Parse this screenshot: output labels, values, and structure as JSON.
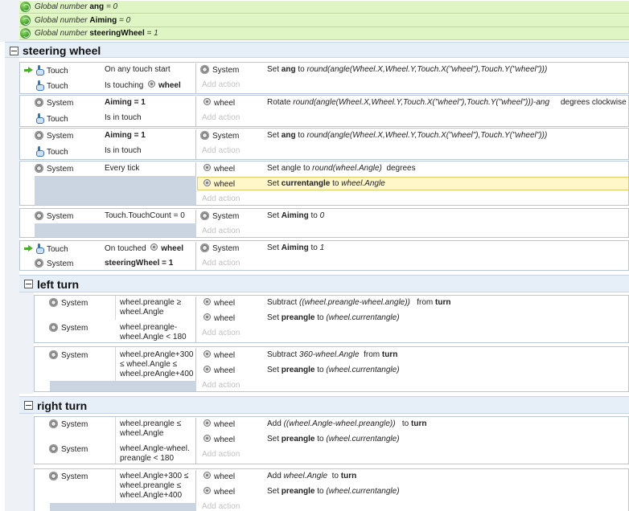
{
  "globals": [
    {
      "prefix": "Global number",
      "name": "ang",
      "suffix": "= 0"
    },
    {
      "prefix": "Global number",
      "name": "Aiming",
      "suffix": "= 0"
    },
    {
      "prefix": "Global number",
      "name": "steeringWheel",
      "suffix": "= 1"
    }
  ],
  "groups": {
    "steering": {
      "title": "steering wheel"
    },
    "left": {
      "title": "left turn"
    },
    "right": {
      "title": "right turn"
    }
  },
  "labels": {
    "touch": "Touch",
    "system": "System",
    "wheel": "wheel",
    "add_action": "Add action"
  },
  "events": {
    "e1": {
      "c1": "On any touch start",
      "c2_pre": "Is touching",
      "c2_obj": "wheel",
      "a1_pre": "Set",
      "a1_var": "ang",
      "a1_mid": "to",
      "a1_expr": "round(angle(Wheel.X,Wheel.Y,Touch.X(\"wheel\"),Touch.Y(\"wheel\")))"
    },
    "e2": {
      "c1": "Aiming = 1",
      "c2": "Is in touch",
      "a1_pre": "Rotate",
      "a1_expr": "round(angle(Wheel.X,Wheel.Y,Touch.X(\"wheel\"),Touch.Y(\"wheel\")))-ang",
      "a1_post": "degrees clockwise"
    },
    "e3": {
      "c1": "Aiming = 1",
      "c2": "Is in touch",
      "a1_pre": "Set",
      "a1_var": "ang",
      "a1_mid": "to",
      "a1_expr": "round(angle(Wheel.X,Wheel.Y,Touch.X(\"wheel\"),Touch.Y(\"wheel\")))"
    },
    "e4": {
      "c1": "Every tick",
      "a1_pre": "Set angle to",
      "a1_expr": "round(wheel.Angle)",
      "a1_post": "degrees",
      "a2_pre": "Set",
      "a2_var": "currentangle",
      "a2_mid": "to",
      "a2_expr": "wheel.Angle"
    },
    "e5": {
      "c1": "Touch.TouchCount = 0",
      "a1_pre": "Set",
      "a1_var": "Aiming",
      "a1_mid": "to",
      "a1_expr": "0"
    },
    "e6": {
      "c1_pre": "On touched",
      "c1_obj": "wheel",
      "c2": "steeringWheel = 1",
      "a1_pre": "Set",
      "a1_var": "Aiming",
      "a1_mid": "to",
      "a1_expr": "1"
    },
    "l1": {
      "c1a": "wheel.preangle ≥",
      "c1b": "wheel.Angle",
      "c2a": "wheel.preangle-",
      "c2b": "wheel.Angle < 180",
      "a1_pre": "Subtract",
      "a1_expr": "((wheel.preangle-wheel.angle))",
      "a1_mid": "from",
      "a1_var": "turn",
      "a2_pre": "Set",
      "a2_var": "preangle",
      "a2_mid": "to",
      "a2_expr": "(wheel.currentangle)"
    },
    "l2": {
      "c1a": "wheel.preAngle+300",
      "c1b": "≤ wheel.Angle ≤",
      "c1c": "wheel.preAngle+400",
      "a1_pre": "Subtract",
      "a1_expr": "360-wheel.Angle",
      "a1_mid": "from",
      "a1_var": "turn",
      "a2_pre": "Set",
      "a2_var": "preangle",
      "a2_mid": "to",
      "a2_expr": "(wheel.currentangle)"
    },
    "r1": {
      "c1a": "wheel.preangle ≤",
      "c1b": "wheel.Angle",
      "c2a": "wheel.Angle-wheel.",
      "c2b": "preangle < 180",
      "a1_pre": "Add",
      "a1_expr": "((wheel.Angle-wheel.preangle))",
      "a1_mid": "to",
      "a1_var": "turn",
      "a2_pre": "Set",
      "a2_var": "preangle",
      "a2_mid": "to",
      "a2_expr": "(wheel.currentangle)"
    },
    "r2": {
      "c1a": "wheel.Angle+300 ≤",
      "c1b": "wheel.preangle ≤",
      "c1c": "wheel.Angle+400",
      "a1_pre": "Add",
      "a1_expr": "wheel.Angle",
      "a1_mid": "to",
      "a1_var": "turn",
      "a2_pre": "Set",
      "a2_var": "preangle",
      "a2_mid": "to",
      "a2_expr": "(wheel.currentangle)"
    }
  }
}
